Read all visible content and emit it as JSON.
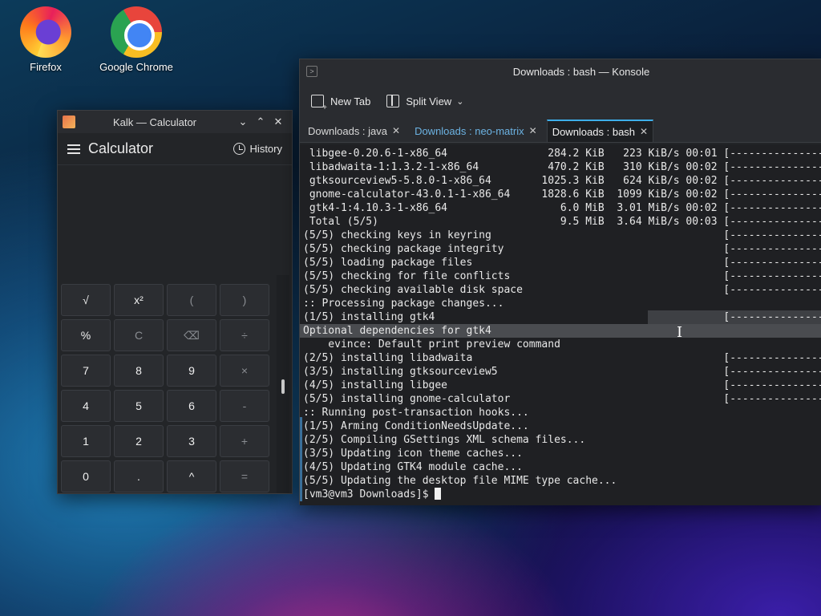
{
  "desktop": {
    "icons": [
      {
        "label": "Firefox",
        "icon": "firefox-icon"
      },
      {
        "label": "Google Chrome",
        "icon": "chrome-icon"
      }
    ]
  },
  "calculator": {
    "window_title": "Kalk — Calculator",
    "header_title": "Calculator",
    "history_label": "History",
    "keys": [
      [
        "√",
        "x²",
        "(",
        ")"
      ],
      [
        "%",
        "C",
        "⌫",
        "÷"
      ],
      [
        "7",
        "8",
        "9",
        "×"
      ],
      [
        "4",
        "5",
        "6",
        "-"
      ],
      [
        "1",
        "2",
        "3",
        "+"
      ],
      [
        "0",
        ".",
        "^",
        "="
      ]
    ]
  },
  "konsole": {
    "window_title": "Downloads : bash — Konsole",
    "toolbar": {
      "new_tab": "New Tab",
      "split_view": "Split View"
    },
    "tabs": [
      {
        "label": "Downloads : java"
      },
      {
        "label": "Downloads : neo-matrix"
      },
      {
        "label": "Downloads : bash"
      }
    ],
    "lines": [
      " libgee-0.20.6-1-x86_64                284.2 KiB   223 KiB/s 00:01 [---------------",
      " libadwaita-1:1.3.2-1-x86_64           470.2 KiB   310 KiB/s 00:02 [---------------",
      " gtksourceview5-5.8.0-1-x86_64        1025.3 KiB   624 KiB/s 00:02 [---------------",
      " gnome-calculator-43.0.1-1-x86_64     1828.6 KiB  1099 KiB/s 00:02 [---------------",
      " gtk4-1:4.10.3-1-x86_64                  6.0 MiB  3.01 MiB/s 00:02 [---------------",
      " Total (5/5)                             9.5 MiB  3.64 MiB/s 00:03 [---------------",
      "(5/5) checking keys in keyring                                     [---------------",
      "(5/5) checking package integrity                                   [---------------",
      "(5/5) loading package files                                        [---------------",
      "(5/5) checking for file conflicts                                  [---------------",
      "(5/5) checking available disk space                                [---------------",
      ":: Processing package changes...",
      "(1/5) installing gtk4                                              [---------------",
      "Optional dependencies for gtk4",
      "    evince: Default print preview command",
      "(2/5) installing libadwaita                                        [---------------",
      "(3/5) installing gtksourceview5                                    [---------------",
      "(4/5) installing libgee                                            [---------------",
      "(5/5) installing gnome-calculator                                  [---------------",
      ":: Running post-transaction hooks...",
      "(1/5) Arming ConditionNeedsUpdate...",
      "(2/5) Compiling GSettings XML schema files...",
      "(3/5) Updating icon theme caches...",
      "(4/5) Updating GTK4 module cache...",
      "(5/5) Updating the desktop file MIME type cache..."
    ],
    "prompt": "[vm3@vm3 Downloads]$ "
  }
}
